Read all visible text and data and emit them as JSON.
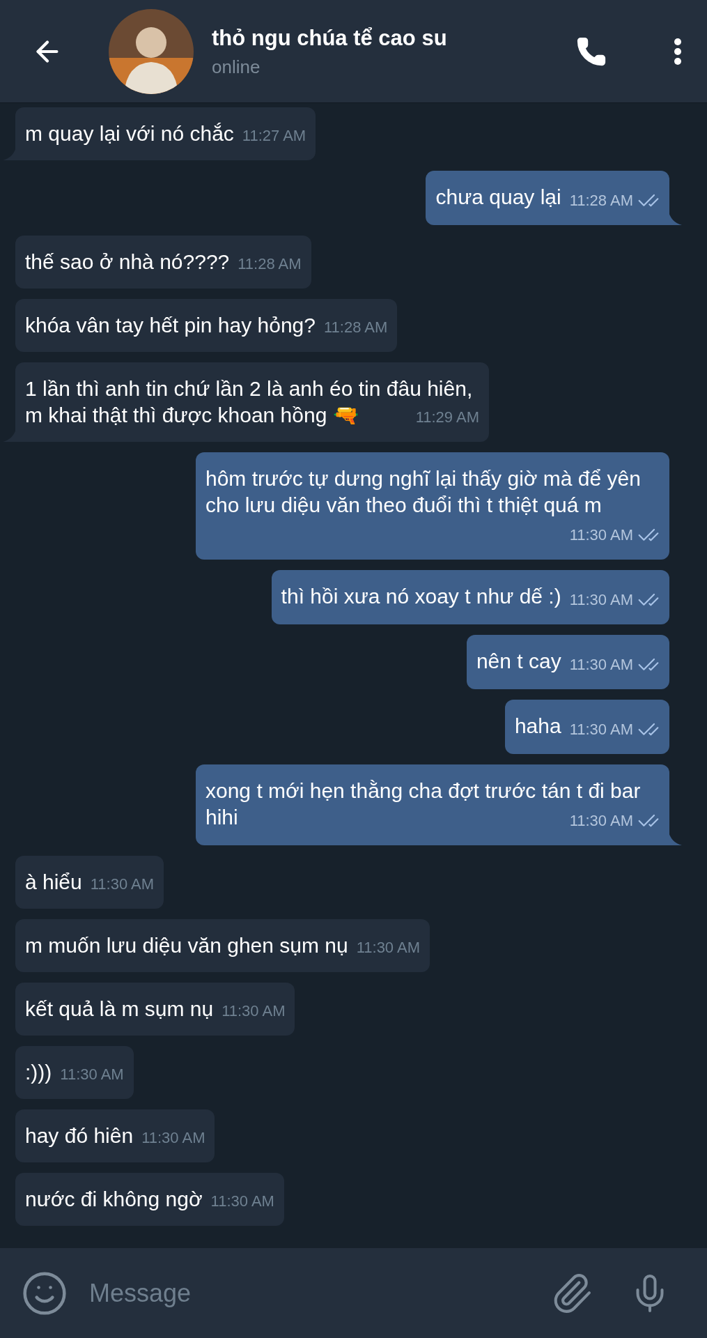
{
  "header": {
    "title": "thỏ ngu chúa tể cao su",
    "status": "online"
  },
  "messages": [
    {
      "outgoing": false,
      "text": "m quay lại với nó chắc",
      "time": "11:27 AM",
      "tail": true
    },
    {
      "outgoing": true,
      "text": "chưa quay lại",
      "time": "11:28 AM",
      "tail": true,
      "read": true
    },
    {
      "outgoing": false,
      "text": "thế sao ở nhà nó????",
      "time": "11:28 AM",
      "tail": false
    },
    {
      "outgoing": false,
      "text": "khóa vân tay hết pin hay hỏng?",
      "time": "11:28 AM",
      "tail": false
    },
    {
      "outgoing": false,
      "text": "1 lần thì anh tin chứ lần 2 là anh éo tin đâu hiên, m khai thật thì được khoan hồng 🔫",
      "time": "11:29 AM",
      "tail": true
    },
    {
      "outgoing": true,
      "text": "hôm trước tự dưng nghĩ lại thấy giờ mà để yên cho lưu diệu văn theo đuổi thì t thiệt quá m",
      "time": "11:30 AM",
      "tail": false,
      "read": true
    },
    {
      "outgoing": true,
      "text": "thì hồi xưa nó xoay t như dế :)",
      "time": "11:30 AM",
      "tail": false,
      "read": true
    },
    {
      "outgoing": true,
      "text": "nên t cay",
      "time": "11:30 AM",
      "tail": false,
      "read": true
    },
    {
      "outgoing": true,
      "text": "haha",
      "time": "11:30 AM",
      "tail": false,
      "read": true
    },
    {
      "outgoing": true,
      "text": "xong t mới hẹn thằng cha đợt trước tán t đi bar hihi",
      "time": "11:30 AM",
      "tail": true,
      "read": true
    },
    {
      "outgoing": false,
      "text": "à hiểu",
      "time": "11:30 AM",
      "tail": false
    },
    {
      "outgoing": false,
      "text": "m muốn lưu diệu văn ghen sụm nụ",
      "time": "11:30 AM",
      "tail": false
    },
    {
      "outgoing": false,
      "text": "kết quả là m sụm nụ",
      "time": "11:30 AM",
      "tail": false
    },
    {
      "outgoing": false,
      "text": ":)))",
      "time": "11:30 AM",
      "tail": false
    },
    {
      "outgoing": false,
      "text": "hay đó hiên",
      "time": "11:30 AM",
      "tail": false
    },
    {
      "outgoing": false,
      "text": "nước đi không ngờ",
      "time": "11:30 AM",
      "tail": false
    }
  ],
  "composer": {
    "placeholder": "Message"
  }
}
